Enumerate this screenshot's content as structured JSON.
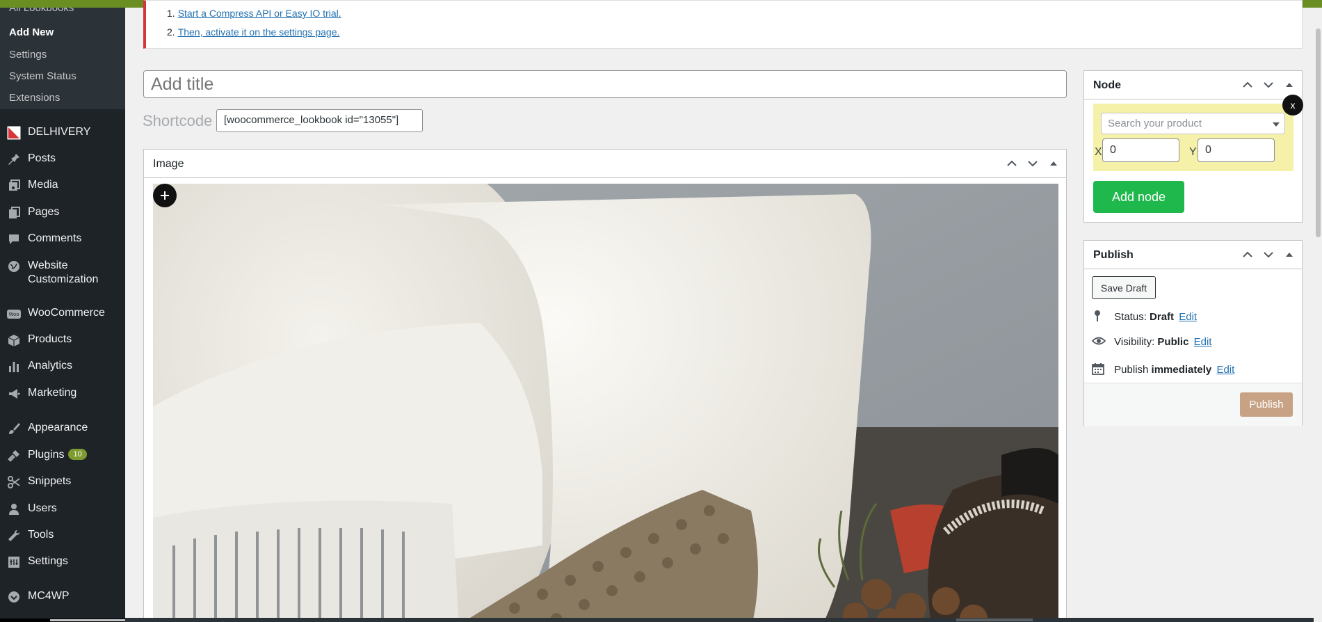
{
  "sidebar": {
    "submenu": {
      "top_partial": "All Lookbooks",
      "items": [
        {
          "label": "Add New",
          "current": true
        },
        {
          "label": "Settings"
        },
        {
          "label": "System Status"
        },
        {
          "label": "Extensions"
        }
      ]
    },
    "menu": [
      {
        "label": "DELHIVERY",
        "icon": "delhivery-icon"
      },
      {
        "label": "Posts",
        "icon": "pin-icon"
      },
      {
        "label": "Media",
        "icon": "media-icon"
      },
      {
        "label": "Pages",
        "icon": "pages-icon"
      },
      {
        "label": "Comments",
        "icon": "comment-icon"
      },
      {
        "label": "Website",
        "label2": "Customization",
        "icon": "globe-icon"
      },
      {
        "label": "WooCommerce",
        "icon": "woo-icon"
      },
      {
        "label": "Products",
        "icon": "box-icon"
      },
      {
        "label": "Analytics",
        "icon": "bar-chart-icon"
      },
      {
        "label": "Marketing",
        "icon": "megaphone-icon"
      },
      {
        "label": "Appearance",
        "icon": "brush-icon"
      },
      {
        "label": "Plugins",
        "icon": "plug-icon",
        "badge": "10"
      },
      {
        "label": "Snippets",
        "icon": "scissors-icon"
      },
      {
        "label": "Users",
        "icon": "user-icon"
      },
      {
        "label": "Tools",
        "icon": "wrench-icon"
      },
      {
        "label": "Settings",
        "icon": "settings-icon"
      },
      {
        "label": "MC4WP",
        "icon": "mc4wp-icon"
      }
    ]
  },
  "notice": {
    "items": [
      {
        "num": "1.",
        "text": "Start a Compress API or Easy IO trial."
      },
      {
        "num": "2.",
        "text": "Then, activate it on the settings page."
      }
    ]
  },
  "editor": {
    "title_placeholder": "Add title",
    "shortcode_label": "Shortcode",
    "shortcode_value": "[woocommerce_lookbook id=\"13055\"]"
  },
  "image_box": {
    "title": "Image",
    "add_pin": "+"
  },
  "node_box": {
    "title": "Node",
    "close": "x",
    "search_placeholder": "Search your product",
    "x_label": "X",
    "y_label": "Y",
    "x_value": "0",
    "y_value": "0",
    "add_node": "Add node"
  },
  "publish_box": {
    "title": "Publish",
    "save_draft": "Save Draft",
    "status_label": "Status:",
    "status_value": "Draft",
    "visibility_label": "Visibility:",
    "visibility_value": "Public",
    "publish_label": "Publish",
    "publish_value": "immediately",
    "edit": "Edit",
    "publish_button": "Publish"
  },
  "colors": {
    "admin_bar": "#6b8e23",
    "sidebar_bg": "#1d2327",
    "add_node_green": "#1fb84d",
    "publish_tan": "#c8a285",
    "notice_red": "#d63638",
    "node_highlight": "#f5f1a8"
  }
}
